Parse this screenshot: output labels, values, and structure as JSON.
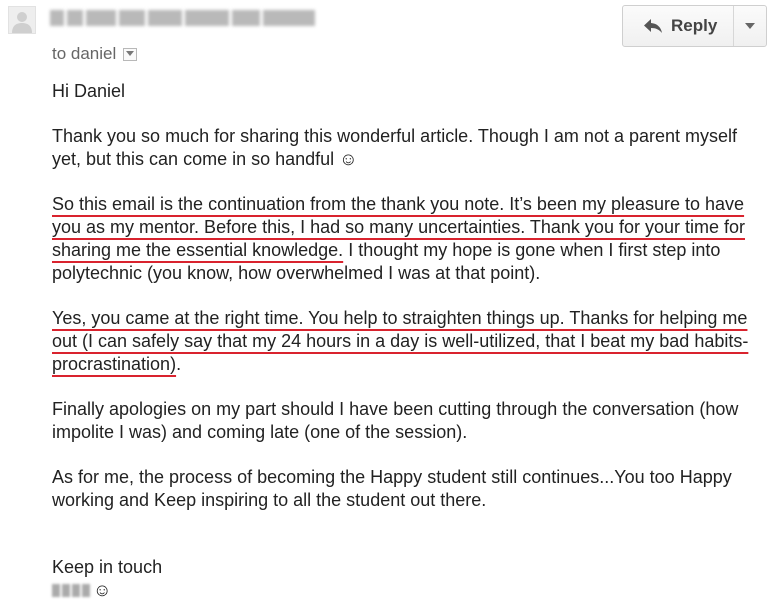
{
  "header": {
    "to_label": "to daniel",
    "reply_label": "Reply"
  },
  "body": {
    "greeting": "Hi Daniel",
    "para1": "Thank you so much for sharing this wonderful article. Though I am not a parent myself yet, but this can come in so handful ☺",
    "para2_highlight": "So this email is the continuation from the thank you note. It’s been my pleasure to have you as my mentor. Before this, I had so many uncertainties. Thank you for your time for sharing me the essential knowledge.",
    "para2_rest": " I thought my hope is gone when I first step into polytechnic (you know, how overwhelmed I was at that point).",
    "para3_highlight": "Yes, you came at the right time. You help to straighten things up. Thanks for helping me out (I can safely say that my 24 hours in a day is well-utilized, that I beat my bad habits- procrastination)",
    "para3_rest": ".",
    "para4": "Finally apologies on my part should I have been cutting through the conversation (how impolite I was) and coming late (one of the session).",
    "para5": "As for me, the process of becoming the Happy student still continues...You too Happy working and Keep inspiring to all the student out there.",
    "closing": "Keep in touch",
    "sign_smiley": "☺"
  },
  "icons": {
    "avatar": "person-silhouette-icon",
    "reply": "reply-arrow-icon",
    "more": "chevron-down-icon",
    "recipients": "chevron-down-icon"
  },
  "colors": {
    "highlight_underline": "#d9232e",
    "text": "#222222",
    "muted": "#666666"
  }
}
